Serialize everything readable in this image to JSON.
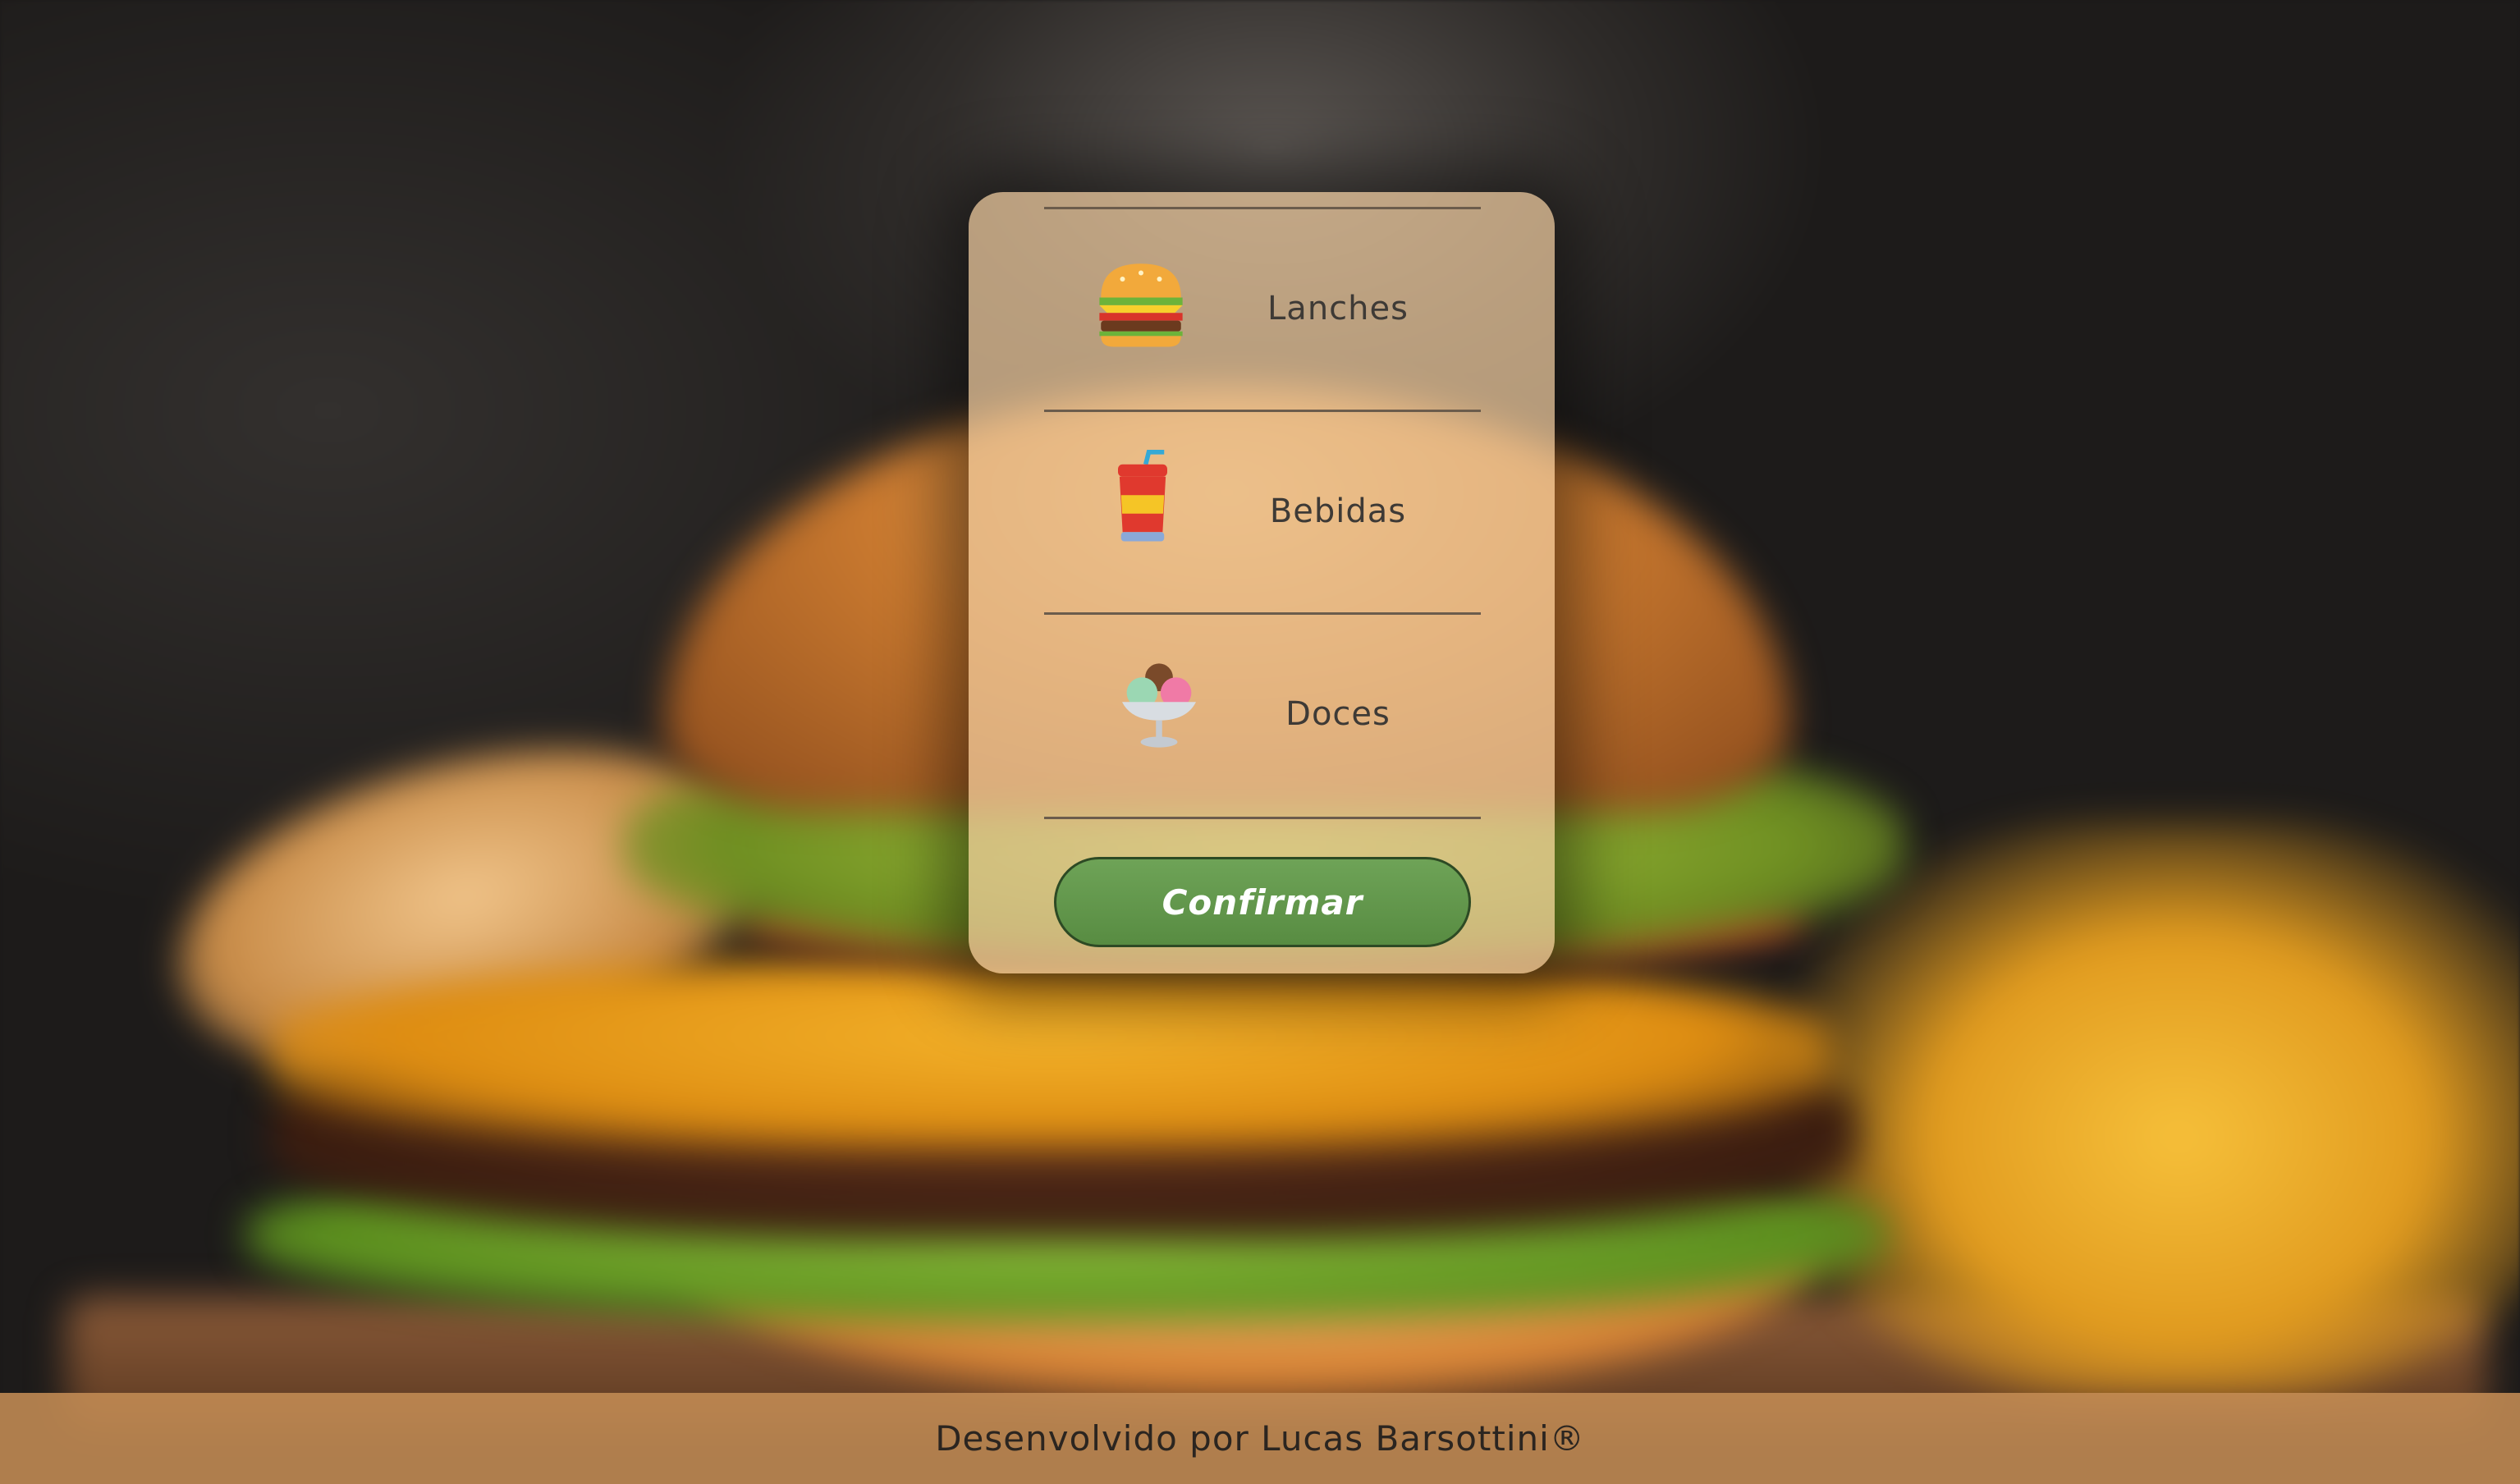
{
  "menu": {
    "items": [
      {
        "label": "Lanches",
        "icon": "hamburger-icon"
      },
      {
        "label": "Bebidas",
        "icon": "soda-cup-icon"
      },
      {
        "label": "Doces",
        "icon": "ice-cream-sundae-icon"
      }
    ],
    "confirm_label": "Confirmar"
  },
  "footer": {
    "credit": "Desenvolvido por Lucas Barsottini®"
  },
  "colors": {
    "card_background": "#EECA9E",
    "confirm_button": "#5F9549",
    "footer_background": "#C48C54",
    "label_text": "#3E3A36"
  }
}
